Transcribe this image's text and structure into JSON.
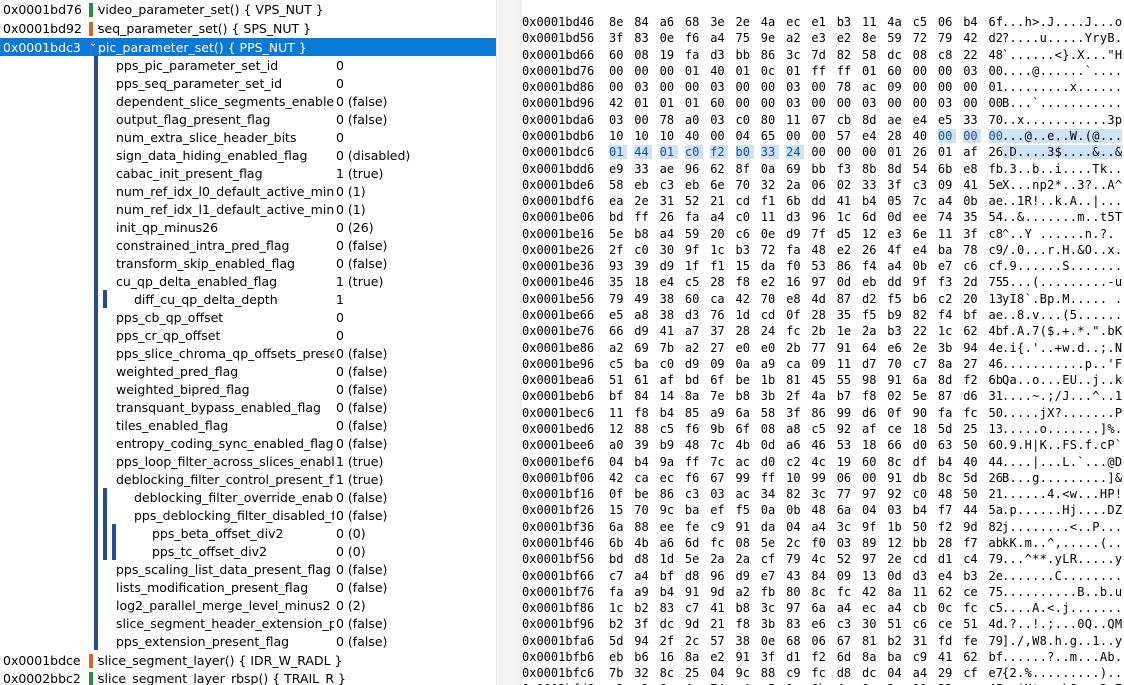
{
  "colors": {
    "selected_bg": "#0a78d7",
    "vps_marker": "#2e8b3e",
    "sps_marker": "#e0602a",
    "pps_marker": "#2e6fce",
    "slice_idr_marker": "#e0602a",
    "slice_trail_marker": "#2e8b3e",
    "field_bar": "#244f86",
    "highlight": "#cfe3f7"
  },
  "tree": {
    "top_nodes": [
      {
        "addr": "0x0001bd76",
        "label": "video_parameter_set() { VPS_NUT }",
        "chevron": "›"
      },
      {
        "addr": "0x0001bd92",
        "label": "seq_parameter_set() { SPS_NUT }",
        "chevron": "›"
      },
      {
        "addr": "0x0001bdc3",
        "label": "pic_parameter_set() { PPS_NUT }",
        "chevron": "⌄"
      }
    ],
    "fields": [
      {
        "name": "pps_pic_parameter_set_id",
        "value": "0",
        "level": 1
      },
      {
        "name": "pps_seq_parameter_set_id",
        "value": "0",
        "level": 1
      },
      {
        "name": "dependent_slice_segments_enabled_fl",
        "value": "0 (false)",
        "level": 1
      },
      {
        "name": "output_flag_present_flag",
        "value": "0 (false)",
        "level": 1
      },
      {
        "name": "num_extra_slice_header_bits",
        "value": "0",
        "level": 1
      },
      {
        "name": "sign_data_hiding_enabled_flag",
        "value": "0 (disabled)",
        "level": 1
      },
      {
        "name": "cabac_init_present_flag",
        "value": "1 (true)",
        "level": 1
      },
      {
        "name": "num_ref_idx_l0_default_active_minus1",
        "value": "0 (1)",
        "level": 1
      },
      {
        "name": "num_ref_idx_l1_default_active_minus1",
        "value": "0 (1)",
        "level": 1
      },
      {
        "name": "init_qp_minus26",
        "value": "0 (26)",
        "level": 1
      },
      {
        "name": "constrained_intra_pred_flag",
        "value": "0 (false)",
        "level": 1
      },
      {
        "name": "transform_skip_enabled_flag",
        "value": "0 (false)",
        "level": 1
      },
      {
        "name": "cu_qp_delta_enabled_flag",
        "value": "1 (true)",
        "level": 1
      },
      {
        "name": "diff_cu_qp_delta_depth",
        "value": "1",
        "level": 2
      },
      {
        "name": "pps_cb_qp_offset",
        "value": "0",
        "level": 1
      },
      {
        "name": "pps_cr_qp_offset",
        "value": "0",
        "level": 1
      },
      {
        "name": "pps_slice_chroma_qp_offsets_present",
        "value": "0 (false)",
        "level": 1
      },
      {
        "name": "weighted_pred_flag",
        "value": "0 (false)",
        "level": 1
      },
      {
        "name": "weighted_bipred_flag",
        "value": "0 (false)",
        "level": 1
      },
      {
        "name": "transquant_bypass_enabled_flag",
        "value": "0 (false)",
        "level": 1
      },
      {
        "name": "tiles_enabled_flag",
        "value": "0 (false)",
        "level": 1
      },
      {
        "name": "entropy_coding_sync_enabled_flag",
        "value": "0 (false)",
        "level": 1
      },
      {
        "name": "pps_loop_filter_across_slices_enabled",
        "value": "1 (true)",
        "level": 1
      },
      {
        "name": "deblocking_filter_control_present_flag",
        "value": "1 (true)",
        "level": 1
      },
      {
        "name": "deblocking_filter_override_enablec",
        "value": "0 (false)",
        "level": 2
      },
      {
        "name": "pps_deblocking_filter_disabled_fla",
        "value": "0 (false)",
        "level": 2
      },
      {
        "name": "pps_beta_offset_div2",
        "value": "0 (0)",
        "level": 3
      },
      {
        "name": "pps_tc_offset_div2",
        "value": "0 (0)",
        "level": 3
      },
      {
        "name": "pps_scaling_list_data_present_flag",
        "value": "0 (false)",
        "level": 1
      },
      {
        "name": "lists_modification_present_flag",
        "value": "0 (false)",
        "level": 1
      },
      {
        "name": "log2_parallel_merge_level_minus2",
        "value": "0 (2)",
        "level": 1
      },
      {
        "name": "slice_segment_header_extension_pres",
        "value": "0 (false)",
        "level": 1
      },
      {
        "name": "pps_extension_present_flag",
        "value": "0 (false)",
        "level": 1
      }
    ],
    "bottom_nodes": [
      {
        "addr": "0x0001bdce",
        "label": "slice_segment_layer() { IDR_W_RADL }",
        "chevron": "›"
      },
      {
        "addr": "0x0002bbc2",
        "label": "slice_segment_layer_rbsp() { TRAIL_R }",
        "chevron": "›"
      }
    ]
  },
  "hex": {
    "rows": [
      {
        "addr": "0x0001bd46",
        "bytes": "8e 84 a6 68 3e 2e 4a ec e1 b3 11 4a c5 06 b4 6f",
        "ascii": "...h>.J....J...o"
      },
      {
        "addr": "0x0001bd56",
        "bytes": "3f 83 0e f6 a4 75 9e a2 e3 e2 8e 59 72 79 42 d2",
        "ascii": "?....u.....YryB."
      },
      {
        "addr": "0x0001bd66",
        "bytes": "60 08 19 fa d3 bb 86 3c 7d 82 58 dc 08 c8 22 48",
        "ascii": "`......<}.X...\"H"
      },
      {
        "addr": "0x0001bd76",
        "bytes": "00 00 00 01 40 01 0c 01 ff ff 01 60 00 00 03 00",
        "ascii": "....@......`...."
      },
      {
        "addr": "0x0001bd86",
        "bytes": "00 03 00 00 03 00 00 03 00 78 ac 09 00 00 00 01",
        "ascii": ".........x......"
      },
      {
        "addr": "0x0001bd96",
        "bytes": "42 01 01 01 60 00 00 03 00 00 03 00 00 03 00 00",
        "ascii": "B...`..........."
      },
      {
        "addr": "0x0001bda6",
        "bytes": "03 00 78 a0 03 c0 80 11 07 cb 8d ae e4 e5 33 70",
        "ascii": "..x...........3p"
      },
      {
        "addr": "0x0001bdb6",
        "bytes": "10 10 10 40 00 04 65 00 00 57 e4 28 40 00 00 00",
        "ascii": "...@..e..W.(@..."
      },
      {
        "addr": "0x0001bdc6",
        "bytes": "01 44 01 c0 f2 b0 33 24 00 00 00 01 26 01 af 26",
        "ascii": ".D....3$....&..&"
      },
      {
        "addr": "0x0001bdd6",
        "bytes": "e9 33 ae 96 62 8f 0a 69 bb f3 8b 8d 54 6b e8 fb",
        "ascii": ".3..b..i....Tk.."
      },
      {
        "addr": "0x0001bde6",
        "bytes": "58 eb c3 eb 6e 70 32 2a 06 02 33 3f c3 09 41 5e",
        "ascii": "X...np2*..3?..A^"
      },
      {
        "addr": "0x0001bdf6",
        "bytes": "ea 2e 31 52 21 cd f1 6b dd 41 b4 05 7c a4 0b ae",
        "ascii": "..1R!..k.A..|..."
      },
      {
        "addr": "0x0001be06",
        "bytes": "bd ff 26 fa a4 c0 11 d3 96 1c 6d 0d ee 74 35 54",
        "ascii": "..&.......m..t5T"
      },
      {
        "addr": "0x0001be16",
        "bytes": "5e b8 a4 59 20 c6 0e d9 7f d5 12 e3 6e 11 3f c8",
        "ascii": "^..Y ......n.?."
      },
      {
        "addr": "0x0001be26",
        "bytes": "2f c0 30 9f 1c b3 72 fa 48 e2 26 4f e4 ba 78 c9",
        "ascii": "/.0...r.H.&O..x."
      },
      {
        "addr": "0x0001be36",
        "bytes": "93 39 d9 1f f1 15 da f0 53 86 f4 a4 0b e7 c6 cf",
        "ascii": ".9......S......."
      },
      {
        "addr": "0x0001be46",
        "bytes": "35 18 e4 c5 28 f8 e2 16 97 0d eb dd 9f f3 2d 75",
        "ascii": "5...(.........-u"
      },
      {
        "addr": "0x0001be56",
        "bytes": "79 49 38 60 ca 42 70 e8 4d 87 d2 f5 b6 c2 20 13",
        "ascii": "yI8`.Bp.M..... ."
      },
      {
        "addr": "0x0001be66",
        "bytes": "e5 a8 38 d3 76 1d cd 0f 28 35 f5 b9 82 f4 bf ae",
        "ascii": "..8.v...(5......"
      },
      {
        "addr": "0x0001be76",
        "bytes": "66 d9 41 a7 37 28 24 fc 2b 1e 2a b3 22 1c 62 4b",
        "ascii": "f.A.7($.+.*.\".bK"
      },
      {
        "addr": "0x0001be86",
        "bytes": "a2 69 7b a2 27 e0 e0 2b 77 91 64 e6 2e 3b 94 4e",
        "ascii": ".i{.'..+w.d..;.N"
      },
      {
        "addr": "0x0001be96",
        "bytes": "c5 ba c0 d9 09 0a a9 ca 09 11 d7 70 c7 8a 27 46",
        "ascii": "...........p..'F"
      },
      {
        "addr": "0x0001bea6",
        "bytes": "51 61 af bd 6f be 1b 81 45 55 98 91 6a 8d f2 6b",
        "ascii": "Qa..o...EU..j..k"
      },
      {
        "addr": "0x0001beb6",
        "bytes": "bf 84 14 8a 7e b8 3b 2f 4a b7 f8 02 5e 87 d6 31",
        "ascii": "....~.;/J...^..1"
      },
      {
        "addr": "0x0001bec6",
        "bytes": "11 f8 b4 85 a9 6a 58 3f 86 99 d6 0f 90 fa fc 50",
        "ascii": ".....jX?.......P"
      },
      {
        "addr": "0x0001bed6",
        "bytes": "12 88 c5 f6 9b 6f 08 a8 c5 92 af ce 18 5d 25 13",
        "ascii": ".....o.......]%."
      },
      {
        "addr": "0x0001bee6",
        "bytes": "a0 39 b9 48 7c 4b 0d a6 46 53 18 66 d0 63 50 60",
        "ascii": ".9.H|K..FS.f.cP`"
      },
      {
        "addr": "0x0001bef6",
        "bytes": "04 b4 9a ff 7c ac d0 c2 4c 19 60 8c df b4 40 44",
        "ascii": "....|...L.`...@D"
      },
      {
        "addr": "0x0001bf06",
        "bytes": "42 ca ec f6 67 99 ff 10 99 06 00 91 db 8c 5d 26",
        "ascii": "B...g.........]&"
      },
      {
        "addr": "0x0001bf16",
        "bytes": "0f be 86 c3 03 ac 34 82 3c 77 97 92 c0 48 50 21",
        "ascii": "......4.<w...HP!"
      },
      {
        "addr": "0x0001bf26",
        "bytes": "15 70 9c ba ef f5 0a 0b 48 6a 04 03 b4 f7 44 5a",
        "ascii": ".p......Hj....DZ"
      },
      {
        "addr": "0x0001bf36",
        "bytes": "6a 88 ee fe c9 91 da 04 a4 3c 9f 1b 50 f2 9d 82",
        "ascii": "j........<..P..."
      },
      {
        "addr": "0x0001bf46",
        "bytes": "6b 4b a6 6d fc 08 5e 2c f0 03 89 12 bb 28 f7 ab",
        "ascii": "kK.m..^,.....(.."
      },
      {
        "addr": "0x0001bf56",
        "bytes": "bd d8 1d 5e 2a 2a cf 79 4c 52 97 2e cd d1 c4 79",
        "ascii": "...^**.yLR.....y"
      },
      {
        "addr": "0x0001bf66",
        "bytes": "c7 a4 bf d8 96 d9 e7 43 84 09 13 0d d3 e4 b3 2e",
        "ascii": ".......C........"
      },
      {
        "addr": "0x0001bf76",
        "bytes": "fa a9 b4 91 9d a2 fb 80 8c fc 42 8a 11 62 ce 75",
        "ascii": "..........B..b.u"
      },
      {
        "addr": "0x0001bf86",
        "bytes": "1c b2 83 c7 41 b8 3c 97 6a a4 ec a4 cb 0c fc c5",
        "ascii": "....A.<.j......."
      },
      {
        "addr": "0x0001bf96",
        "bytes": "b2 3f dc 9d 21 f8 3b 83 e6 c3 30 51 c6 ce 51 4d",
        "ascii": ".?..!.;...0Q..QM"
      },
      {
        "addr": "0x0001bfa6",
        "bytes": "5d 94 2f 2c 57 38 0e 68 06 67 81 b2 31 fd fe 79",
        "ascii": "]./,W8.h.g..1..y"
      },
      {
        "addr": "0x0001bfb6",
        "bytes": "eb b6 16 8a e2 91 3f d1 f2 6d 8a ba c9 41 62 bf",
        "ascii": "......?..m...Ab."
      },
      {
        "addr": "0x0001bfc6",
        "bytes": "7b 32 8c 25 04 9c 88 c9 fc d8 dc 04 a4 29 cf e7",
        "ascii": "{2.%.........)..."
      },
      {
        "addr": "0x0001bfd6",
        "bytes": "c2 c2 6a 4e 74 e4 e5 1c 6b 4a 0a 2e 11 33 ae 45",
        "ascii": "..jNt...kJ...3.E"
      }
    ]
  }
}
